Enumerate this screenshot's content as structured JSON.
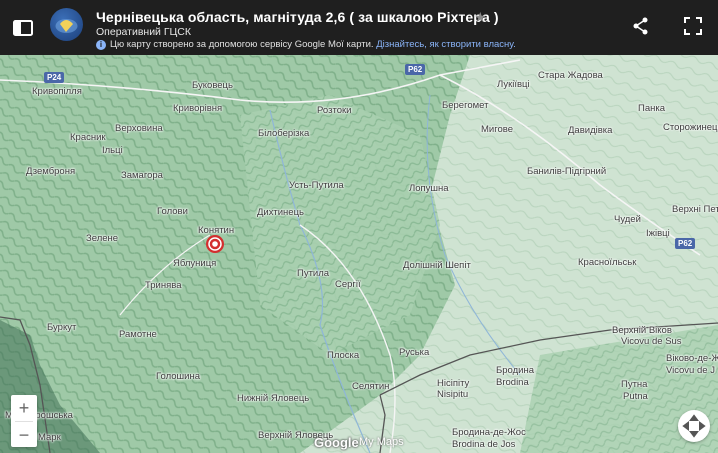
{
  "header": {
    "title": "Чернівецька область, магнітуда 2,6 ( за шкалою Ріхтера )",
    "subtitle": "Оперативний ГЦСК",
    "info_text": "Цю карту створено за допомогою сервісу Google Мої карти. ",
    "info_link": "Дізнайтесь, як створити власну.",
    "info_icon": "i",
    "star_icon": "★"
  },
  "map": {
    "places": [
      {
        "label": "Криворівня"
      },
      {
        "label": "Буковець"
      },
      {
        "label": "Кривопілля"
      },
      {
        "label": "Верховина"
      },
      {
        "label": "Красник"
      },
      {
        "label": "Ільці"
      },
      {
        "label": "Замагора"
      },
      {
        "label": "Дземброня"
      },
      {
        "label": "Голови"
      },
      {
        "label": "Зелене"
      },
      {
        "label": "Конятин"
      },
      {
        "label": "Яблуниця"
      },
      {
        "label": "Тринява"
      },
      {
        "label": "Буркут"
      },
      {
        "label": "Рамотне"
      },
      {
        "label": "Голошина"
      },
      {
        "label": "Нижній Яловець"
      },
      {
        "label": "Верхній Яловець"
      },
      {
        "label": "Білоберізка"
      },
      {
        "label": "Розтоки"
      },
      {
        "label": "Усть-Путила"
      },
      {
        "label": "Дихтинець"
      },
      {
        "label": "Путила"
      },
      {
        "label": "Сергії"
      },
      {
        "label": "Плоска"
      },
      {
        "label": "Селятин"
      },
      {
        "label": "Руська"
      },
      {
        "label": "Лопушна"
      },
      {
        "label": "Долішній Шепіт"
      },
      {
        "label": "Берегомет"
      },
      {
        "label": "Лукіївці"
      },
      {
        "label": "Стара Жадова"
      },
      {
        "label": "Мигове"
      },
      {
        "label": "Давидівка"
      },
      {
        "label": "Панка"
      },
      {
        "label": "Сторожинець"
      },
      {
        "label": "Банилів-Підгірний"
      },
      {
        "label": "Чудей"
      },
      {
        "label": "Верхні Петрівці"
      },
      {
        "label": "Іжівці"
      },
      {
        "label": "Красноїльськ"
      },
      {
        "label": "Верхній Віков"
      },
      {
        "label": "Vicovu de Sus"
      },
      {
        "label": "Віково-де-Ж"
      },
      {
        "label": "Vicovu de J"
      },
      {
        "label": "Нісіпіту"
      },
      {
        "label": "Nisipitu"
      },
      {
        "label": "Бродина"
      },
      {
        "label": "Brodina"
      },
      {
        "label": "Путна"
      },
      {
        "label": "Putna"
      },
      {
        "label": "Бродина-де-Жос"
      },
      {
        "label": "Brodina de Jos"
      },
      {
        "label": "Мармарошська"
      },
      {
        "label": "Марк"
      }
    ],
    "roads": [
      "P24",
      "P62",
      "P62"
    ],
    "zoom_in": "+",
    "zoom_out": "−",
    "attribution_logo": "Google",
    "attribution_text": "My Maps",
    "marker_icon": "earthquake-marker"
  },
  "colors": {
    "marker": "#d32f2f",
    "header_bg": "#1f1f1f",
    "link": "#8ab4f8"
  }
}
